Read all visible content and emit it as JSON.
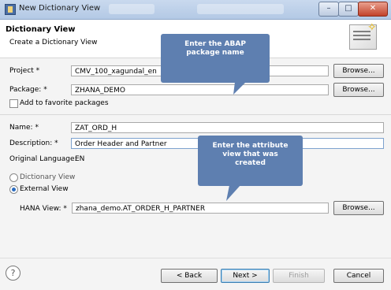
{
  "window": {
    "title": "New Dictionary View",
    "controls": {
      "minimize": "–",
      "maximize": "□",
      "close": "✕"
    }
  },
  "header": {
    "title": "Dictionary View",
    "subtitle": "Create a Dictionary View"
  },
  "form": {
    "project": {
      "label": "Project *",
      "value": "CMV_100_xagundal_en",
      "browse": "Browse..."
    },
    "package": {
      "label": "Package: *",
      "value": "ZHANA_DEMO",
      "browse": "Browse..."
    },
    "favorite": {
      "label": "Add to favorite packages"
    },
    "name": {
      "label": "Name: *",
      "value": "ZAT_ORD_H"
    },
    "description": {
      "label": "Description: *",
      "value": "Order Header and Partner"
    },
    "original_language": {
      "label": "Original Language:",
      "value": "EN"
    },
    "view_type": {
      "dictionary": "Dictionary View",
      "external": "External View",
      "selected": "External View"
    },
    "hana_view": {
      "label": "HANA View: *",
      "value": "zhana_demo.AT_ORDER_H_PARTNER",
      "browse": "Browse..."
    }
  },
  "callouts": {
    "package_hint": "Enter the ABAP package name",
    "view_hint": "Enter the attribute view that was created"
  },
  "footer": {
    "help": "?",
    "back": "< Back",
    "next": "Next >",
    "finish": "Finish",
    "cancel": "Cancel"
  },
  "colors": {
    "callout": "#5e7fb0",
    "title_bar": "#c9d9ee",
    "body": "#f4f4f4"
  }
}
